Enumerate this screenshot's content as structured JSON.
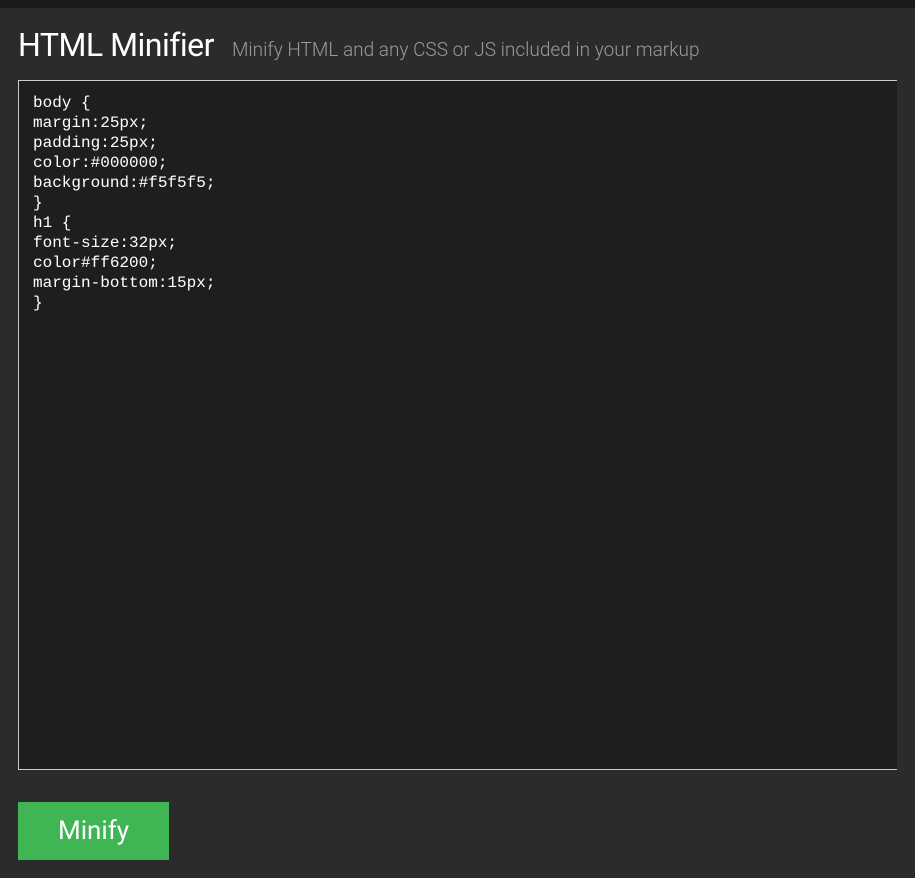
{
  "header": {
    "title": "HTML Minifier",
    "subtitle": "Minify HTML and any CSS or JS included in your markup"
  },
  "editor": {
    "value": "body {\nmargin:25px;\npadding:25px;\ncolor:#000000;\nbackground:#f5f5f5;\n}\nh1 {\nfont-size:32px;\ncolor#ff6200;\nmargin-bottom:15px;\n}"
  },
  "actions": {
    "minify_label": "Minify"
  }
}
